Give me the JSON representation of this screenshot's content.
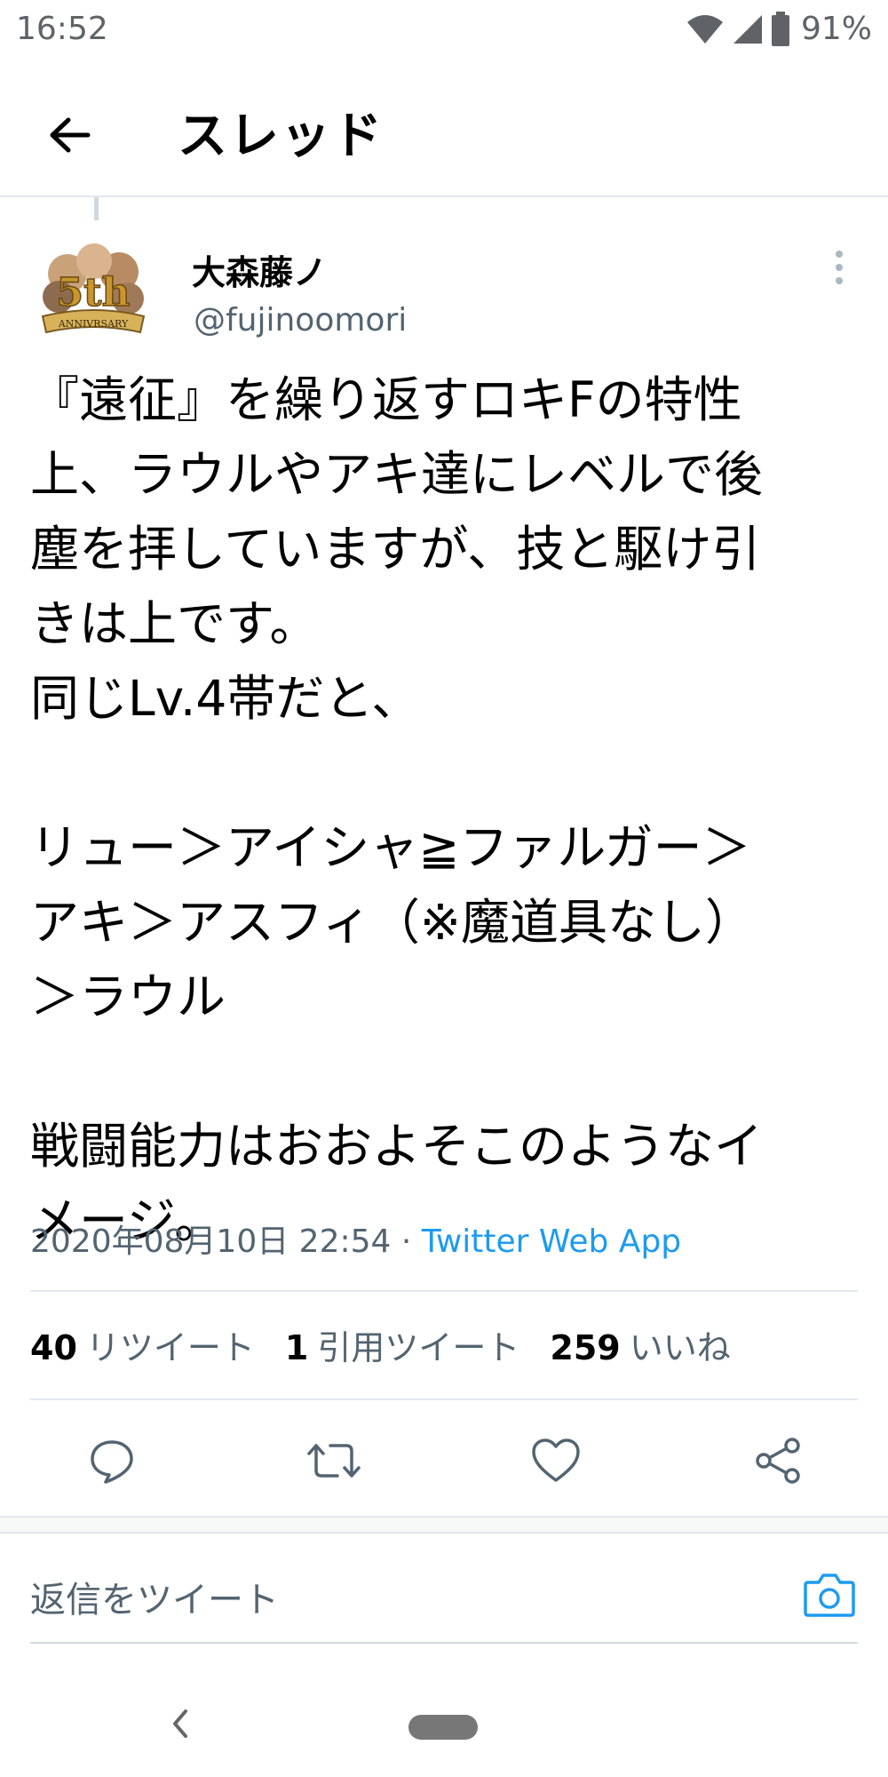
{
  "status_bar": {
    "time": "16:52",
    "battery_percent": "91%",
    "icons": [
      "wifi-icon",
      "signal-icon",
      "battery-icon"
    ]
  },
  "header": {
    "title": "スレッド",
    "back_icon": "arrow-left-icon"
  },
  "tweet": {
    "author_name": "大森藤ノ",
    "author_handle": "@fujinoomori",
    "avatar_icon": "avatar-5th-anniversary",
    "avatar_text": {
      "big": "5th",
      "ribbon": "ANNIVRSARY"
    },
    "text": "『遠征』を繰り返すロキFの特性\n上、ラウルやアキ達にレベルで後\n塵を拝していますが、技と駆け引\nきは上です。\n同じLv.4帯だと、\n\nリュー＞アイシャ≧ファルガー＞\nアキ＞アスフィ（※魔道具なし）\n＞ラウル\n\n戦闘能力はおおよそこのようなイ\nメージ。",
    "timestamp": "2020年08月10日 22:54",
    "separator": " · ",
    "source": "Twitter Web App",
    "stats": {
      "retweets_count": "40",
      "retweets_label": "リツイート",
      "quotes_count": "1",
      "quotes_label": "引用ツイート",
      "likes_count": "259",
      "likes_label": "いいね"
    },
    "actions": [
      "reply-icon",
      "retweet-icon",
      "like-icon",
      "share-icon"
    ]
  },
  "reply": {
    "placeholder": "返信をツイート",
    "camera_icon": "camera-icon"
  },
  "colors": {
    "accent": "#1d9bf0",
    "secondary_text": "#536471",
    "divider": "#e1e8ed"
  }
}
